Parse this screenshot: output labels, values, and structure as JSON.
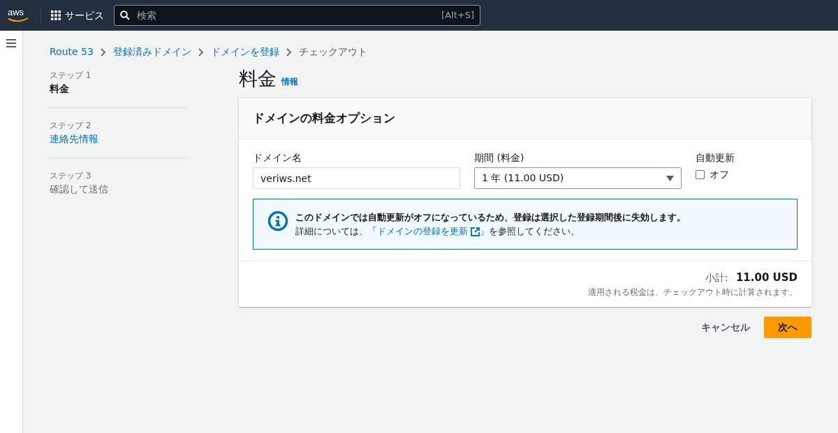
{
  "topbar": {
    "logo": "aws",
    "services_label": "サービス",
    "search": {
      "placeholder": "検索",
      "shortcut": "[Alt+S]"
    }
  },
  "breadcrumbs": [
    {
      "label": "Route 53",
      "link": true
    },
    {
      "label": "登録済みドメイン",
      "link": true
    },
    {
      "label": "ドメインを登録",
      "link": true
    },
    {
      "label": "チェックアウト",
      "link": false
    }
  ],
  "steps": [
    {
      "caption": "ステップ 1",
      "label": "料金",
      "selected": true,
      "disabled": false
    },
    {
      "caption": "ステップ 2",
      "label": "連絡先情報",
      "selected": false,
      "disabled": false
    },
    {
      "caption": "ステップ 3",
      "label": "確認して送信",
      "selected": false,
      "disabled": true
    }
  ],
  "page_title": "料金",
  "info_link": "情報",
  "panel": {
    "title": "ドメインの料金オプション",
    "domain": {
      "label": "ドメイン名",
      "value": "veriws.net"
    },
    "period": {
      "label": "期間 (料金)",
      "value": "1 年 (11.00 USD)"
    },
    "auto_renew": {
      "label": "自動更新",
      "option": "オフ",
      "checked": false
    },
    "alert": {
      "headline": "このドメインでは自動更新がオフになっているため、登録は選択した登録期間後に失効します。",
      "text_before": "詳細については、「",
      "link": "ドメインの登録を更新",
      "text_after": "」を参照してください。"
    },
    "subtotal_label": "小計:",
    "subtotal_value": "11.00 USD",
    "tax_note": "適用される税金は、チェックアウト時に計算されます。"
  },
  "buttons": {
    "cancel": "キャンセル",
    "next": "次へ"
  }
}
